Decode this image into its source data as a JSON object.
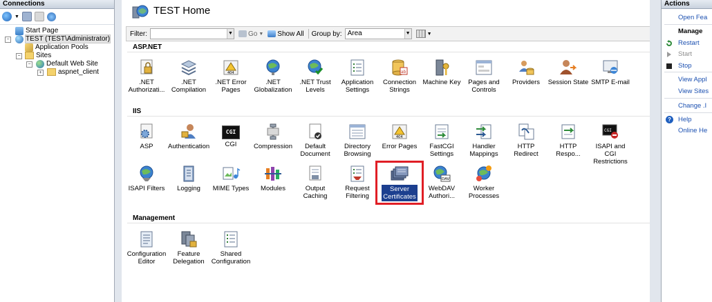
{
  "connections": {
    "title": "Connections",
    "tree": [
      {
        "label": "Start Page"
      },
      {
        "label": "TEST (TEST\\Administrator)"
      },
      {
        "label": "Application Pools"
      },
      {
        "label": "Sites"
      },
      {
        "label": "Default Web Site"
      },
      {
        "label": "aspnet_client"
      }
    ]
  },
  "header": {
    "title": "TEST Home"
  },
  "filterbar": {
    "filter_label": "Filter:",
    "go_label": "Go",
    "show_all_label": "Show All",
    "group_by_label": "Group by:",
    "group_by_value": "Area"
  },
  "sections": [
    {
      "title": "ASP.NET"
    },
    {
      "title": "IIS"
    },
    {
      "title": "Management"
    }
  ],
  "aspnet": [
    {
      "label": ".NET\nAuthorizati..."
    },
    {
      "label": ".NET\nCompilation"
    },
    {
      "label": ".NET Error\nPages"
    },
    {
      "label": ".NET\nGlobalization"
    },
    {
      "label": ".NET Trust\nLevels"
    },
    {
      "label": "Application\nSettings"
    },
    {
      "label": "Connection\nStrings"
    },
    {
      "label": "Machine Key"
    },
    {
      "label": "Pages and\nControls"
    },
    {
      "label": "Providers"
    },
    {
      "label": "Session State"
    },
    {
      "label": "SMTP E-mail"
    }
  ],
  "iis": [
    {
      "label": "ASP"
    },
    {
      "label": "Authentication"
    },
    {
      "label": "CGI",
      "icon_text": "CGI"
    },
    {
      "label": "Compression"
    },
    {
      "label": "Default\nDocument"
    },
    {
      "label": "Directory\nBrowsing"
    },
    {
      "label": "Error Pages"
    },
    {
      "label": "FastCGI\nSettings"
    },
    {
      "label": "Handler\nMappings"
    },
    {
      "label": "HTTP Redirect"
    },
    {
      "label": "HTTP\nRespo..."
    },
    {
      "label": "ISAPI and CGI\nRestrictions"
    },
    {
      "label": "ISAPI Filters"
    },
    {
      "label": "Logging"
    },
    {
      "label": "MIME Types"
    },
    {
      "label": "Modules"
    },
    {
      "label": "Output\nCaching"
    },
    {
      "label": "Request\nFiltering"
    },
    {
      "label": "Server\nCertificates"
    },
    {
      "label": "WebDAV\nAuthori..."
    },
    {
      "label": "Worker\nProcesses"
    }
  ],
  "management": [
    {
      "label": "Configuration\nEditor"
    },
    {
      "label": "Feature\nDelegation"
    },
    {
      "label": "Shared\nConfiguration"
    }
  ],
  "actions": {
    "title": "Actions",
    "open_feature": "Open Fea",
    "manage_header": "Manage",
    "restart": "Restart",
    "start": "Start",
    "stop": "Stop",
    "view_app_pools": "View Appl",
    "view_sites": "View Sites",
    "change_net": "Change .I",
    "help": "Help",
    "online_help": "Online He"
  },
  "colors": {
    "accent": "#1c3f8f",
    "highlight_box": "#e01e25",
    "link": "#1a4fb0"
  }
}
